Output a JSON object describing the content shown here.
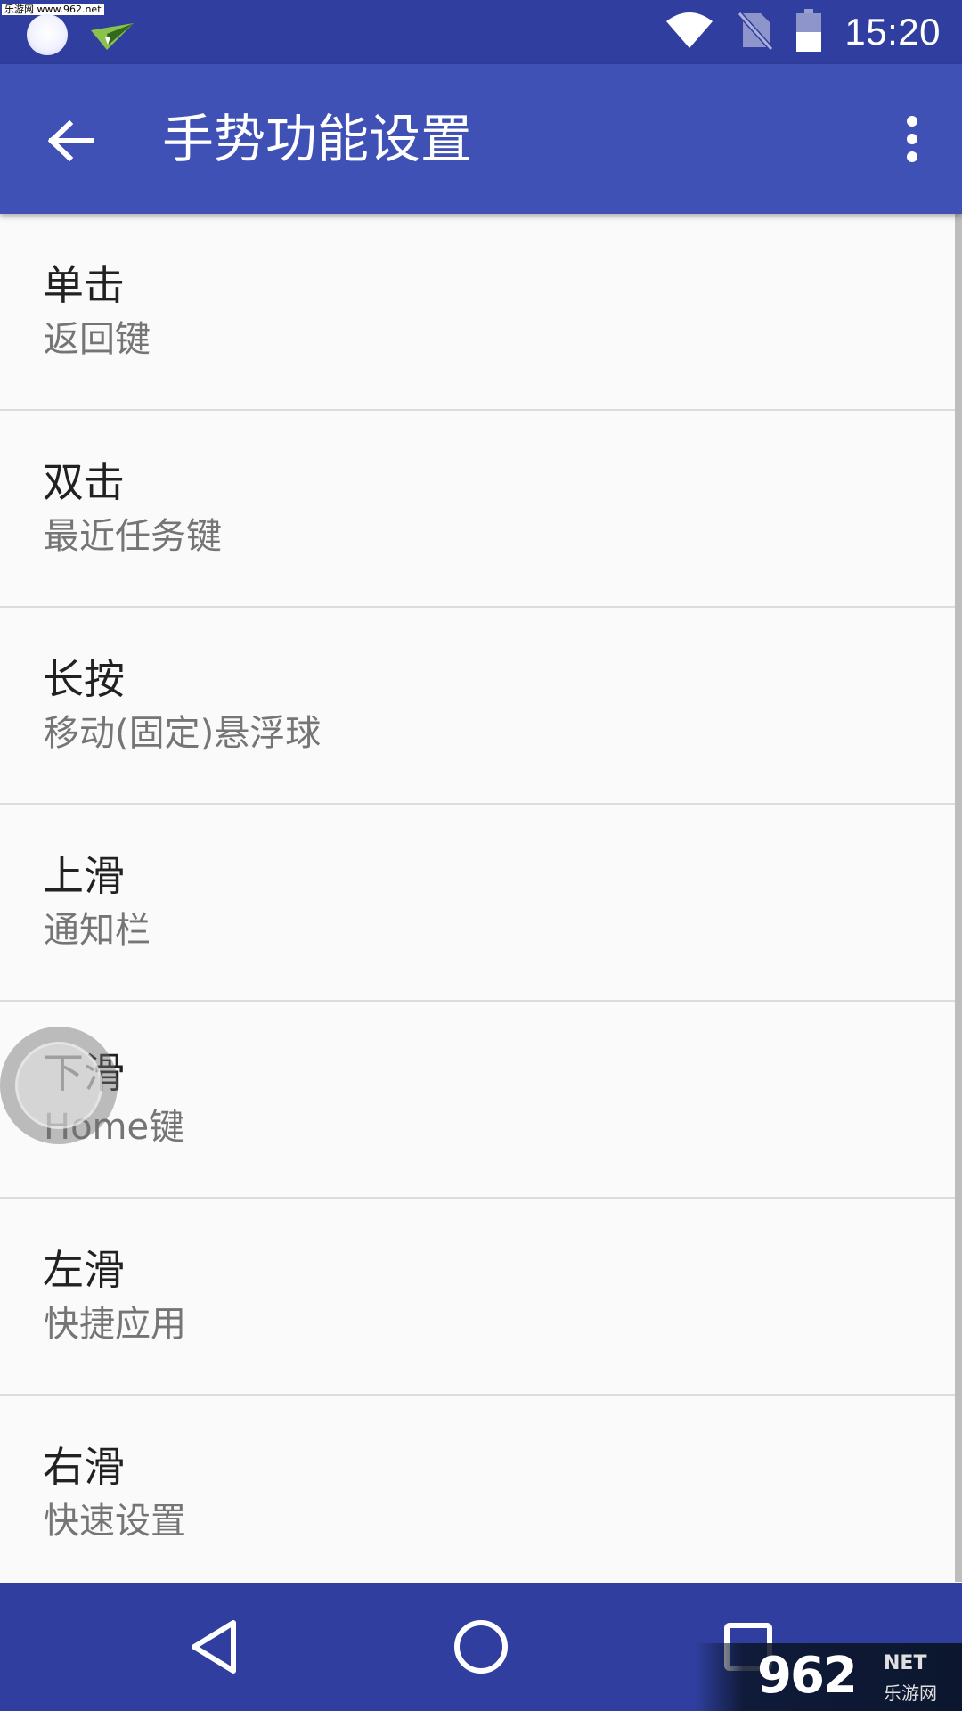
{
  "status_bar": {
    "watermark_text": "乐游网 www.962.net",
    "time": "15:20",
    "icons": [
      "floating-ball-notification-icon",
      "paper-plane-icon",
      "wifi-icon",
      "no-sim-icon",
      "battery-icon"
    ]
  },
  "app_bar": {
    "title": "手势功能设置",
    "back_icon": "arrow-back-icon",
    "more_icon": "more-vert-icon"
  },
  "gestures": [
    {
      "title": "单击",
      "summary": "返回键"
    },
    {
      "title": "双击",
      "summary": "最近任务键"
    },
    {
      "title": "长按",
      "summary": "移动(固定)悬浮球"
    },
    {
      "title": "上滑",
      "summary": "通知栏"
    },
    {
      "title": "下滑",
      "summary": "Home键"
    },
    {
      "title": "左滑",
      "summary": "快捷应用"
    },
    {
      "title": "右滑",
      "summary": "快速设置"
    }
  ],
  "nav_bar": {
    "buttons": [
      "back-triangle-icon",
      "home-circle-icon",
      "recents-square-icon"
    ]
  },
  "watermark": {
    "logo_digits": "962",
    "logo_net": "NET",
    "logo_sub": "乐游网"
  },
  "colors": {
    "primary": "#3f51b5",
    "primary_dark": "#303f9f",
    "background": "#fafafa",
    "title_text": "#212121",
    "summary_text": "#757575",
    "divider": "#dcdcdc"
  }
}
